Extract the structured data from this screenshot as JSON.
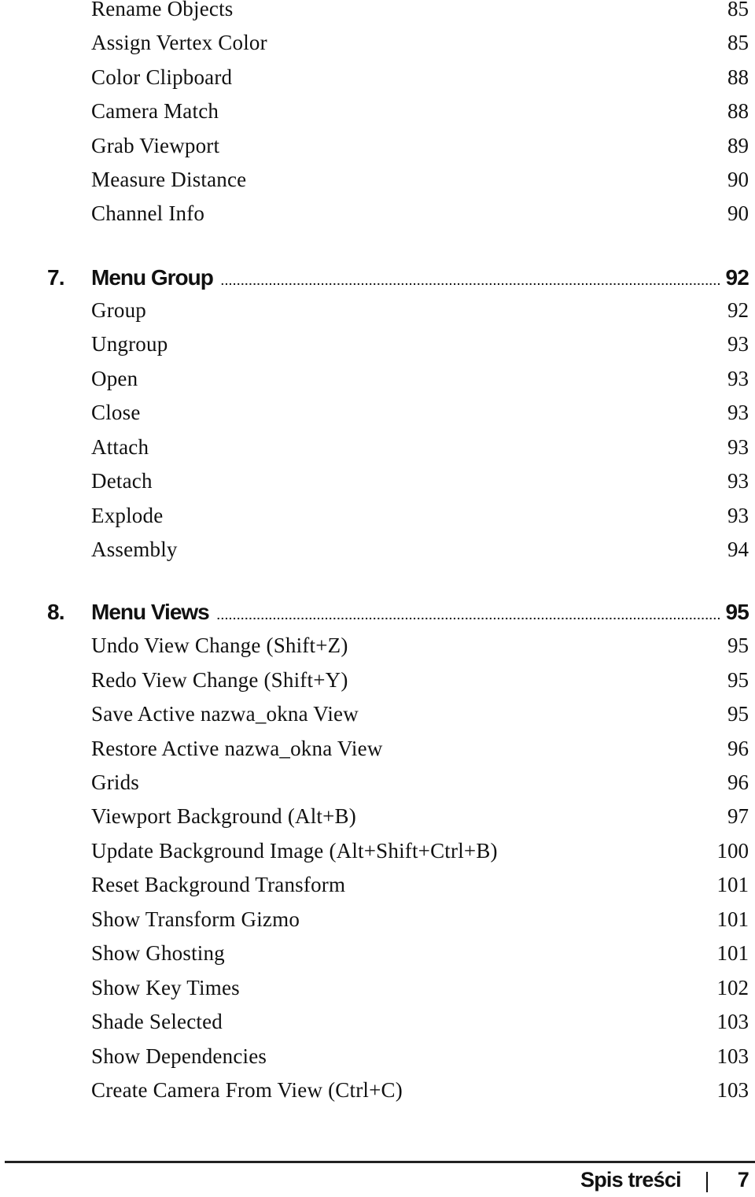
{
  "toc": {
    "continued_entries": [
      {
        "title": "Rename Objects",
        "page": "85"
      },
      {
        "title": "Assign Vertex Color",
        "page": "85"
      },
      {
        "title": "Color Clipboard",
        "page": "88"
      },
      {
        "title": "Camera Match",
        "page": "88"
      },
      {
        "title": "Grab Viewport",
        "page": "89"
      },
      {
        "title": "Measure Distance",
        "page": "90"
      },
      {
        "title": "Channel Info",
        "page": "90"
      }
    ],
    "chapters": [
      {
        "number": "7.",
        "title": "Menu Group",
        "page": "92",
        "entries": [
          {
            "title": "Group",
            "page": "92"
          },
          {
            "title": "Ungroup",
            "page": "93"
          },
          {
            "title": "Open",
            "page": "93"
          },
          {
            "title": "Close",
            "page": "93"
          },
          {
            "title": "Attach",
            "page": "93"
          },
          {
            "title": "Detach",
            "page": "93"
          },
          {
            "title": "Explode",
            "page": "93"
          },
          {
            "title": "Assembly",
            "page": "94"
          }
        ]
      },
      {
        "number": "8.",
        "title": "Menu Views",
        "page": "95",
        "entries": [
          {
            "title": "Undo View Change (Shift+Z)",
            "page": "95"
          },
          {
            "title": "Redo View Change (Shift+Y)",
            "page": "95"
          },
          {
            "title": "Save Active nazwa_okna View",
            "page": "95"
          },
          {
            "title": "Restore Active nazwa_okna View",
            "page": "96"
          },
          {
            "title": "Grids",
            "page": "96"
          },
          {
            "title": "Viewport Background (Alt+B)",
            "page": "97"
          },
          {
            "title": "Update Background Image (Alt+Shift+Ctrl+B)",
            "page": "100"
          },
          {
            "title": "Reset Background Transform",
            "page": "101"
          },
          {
            "title": "Show Transform Gizmo",
            "page": "101"
          },
          {
            "title": "Show Ghosting",
            "page": "101"
          },
          {
            "title": "Show Key Times",
            "page": "102"
          },
          {
            "title": "Shade Selected",
            "page": "103"
          },
          {
            "title": "Show Dependencies",
            "page": "103"
          },
          {
            "title": "Create Camera From View (Ctrl+C)",
            "page": "103"
          }
        ]
      }
    ]
  },
  "footer": {
    "section": "Spis treści",
    "page_number": "7"
  }
}
